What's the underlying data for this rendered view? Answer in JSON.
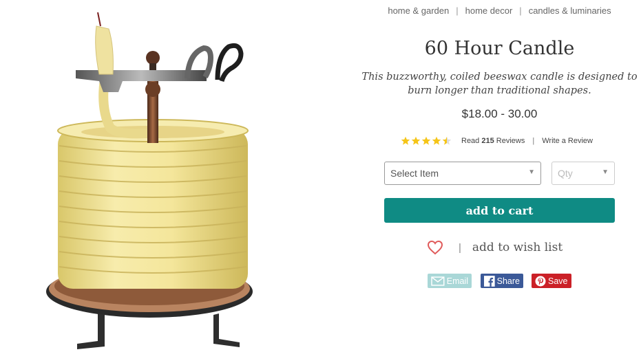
{
  "breadcrumb": [
    "home & garden",
    "home decor",
    "candles & luminaries"
  ],
  "breadcrumb_separator": "|",
  "product": {
    "title": "60 Hour Candle",
    "tagline": "This buzzworthy, coiled beeswax candle is designed to burn longer than traditional shapes.",
    "price": "$18.00 - 30.00",
    "rating": 4.5,
    "rating_max": 5
  },
  "reviews": {
    "read_prefix": "Read",
    "count": "215",
    "read_suffix": "Reviews",
    "separator": "|",
    "write_label": "Write a Review"
  },
  "options": {
    "item_placeholder": "Select Item",
    "qty_placeholder": "Qty"
  },
  "actions": {
    "add_to_cart": "add to cart",
    "wish_separator": "|",
    "wish_list": "add to wish list"
  },
  "share": {
    "email": "Email",
    "facebook": "Share",
    "pinterest": "Save"
  },
  "colors": {
    "accent": "#0f8b84",
    "star": "#f5c518",
    "heart": "#e05a5a",
    "email": "#a9d7d7",
    "facebook": "#3b5998",
    "pinterest": "#cb2027"
  },
  "icons": [
    "star-icon",
    "heart-icon",
    "email-icon",
    "facebook-icon",
    "pinterest-icon",
    "dropdown-arrow-icon"
  ]
}
